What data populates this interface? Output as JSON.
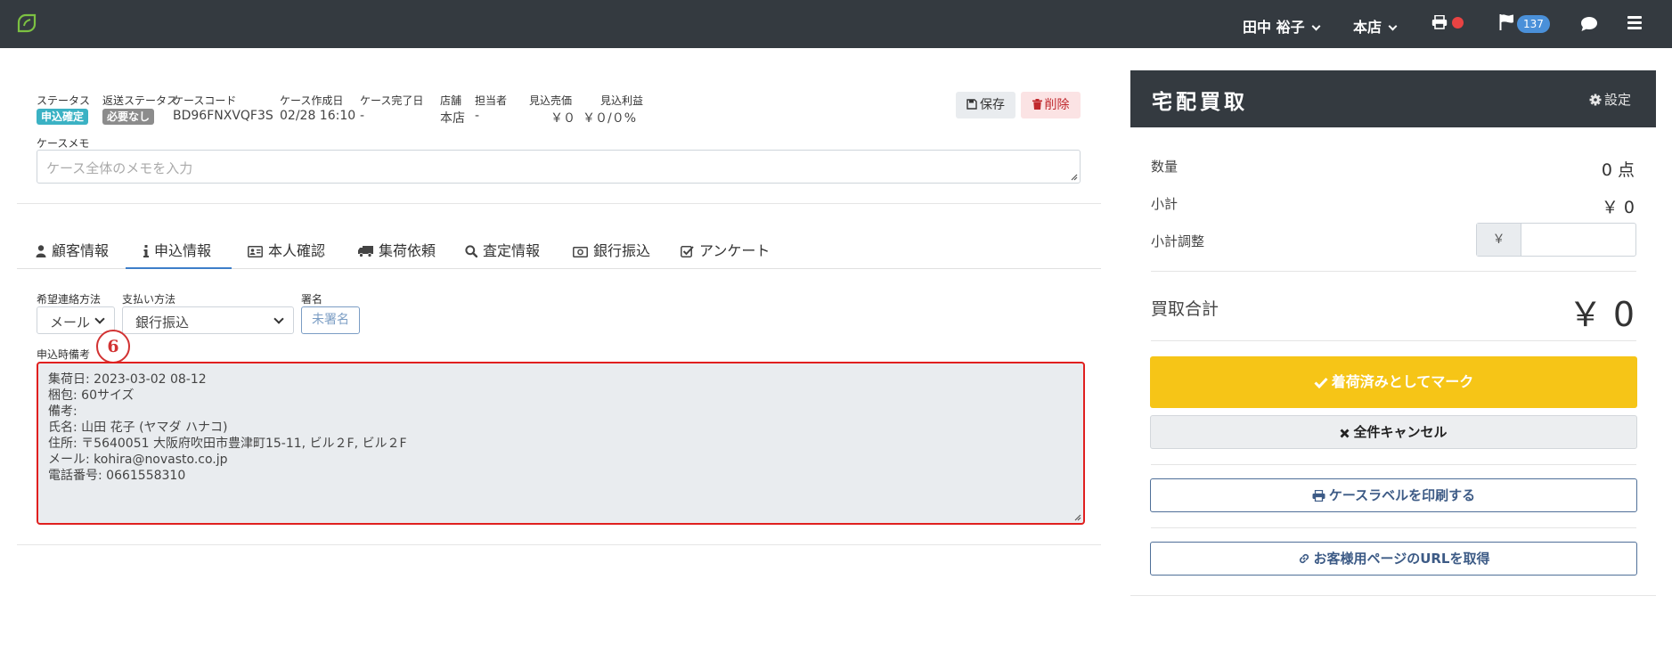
{
  "nav": {
    "user_name": "田中 裕子",
    "store": "本店",
    "notification_count": "137"
  },
  "case": {
    "labels": {
      "status": "ステータス",
      "return_status": "返送ステータス",
      "case_code": "ケースコード",
      "created": "ケース作成日",
      "completed": "ケース完了日",
      "store": "店舗",
      "staff": "担当者",
      "expected_sales": "見込売価",
      "expected_profit": "見込利益"
    },
    "status_badge": "申込確定",
    "return_status_badge": "必要なし",
    "case_code": "BD96FNXVQF3S",
    "created": "02/28 16:10",
    "completed": "-",
    "store": "本店",
    "staff": "-",
    "expected_sales": "￥０",
    "expected_profit": "￥０/０%",
    "save_label": "保存",
    "delete_label": "削除",
    "memo_label": "ケースメモ",
    "memo_placeholder": "ケース全体のメモを入力"
  },
  "tabs": [
    {
      "label": "顧客情報",
      "icon": "user-icon"
    },
    {
      "label": "申込情報",
      "icon": "info-icon"
    },
    {
      "label": "本人確認",
      "icon": "id-card-icon"
    },
    {
      "label": "集荷依頼",
      "icon": "truck-icon"
    },
    {
      "label": "査定情報",
      "icon": "search-icon"
    },
    {
      "label": "銀行振込",
      "icon": "money-icon"
    },
    {
      "label": "アンケート",
      "icon": "checkbox-icon"
    }
  ],
  "form": {
    "contact_label": "希望連絡方法",
    "contact_value": "メール",
    "payment_label": "支払い方法",
    "payment_value": "銀行振込",
    "sign_label": "署名",
    "sign_button": "未署名",
    "remarks_label": "申込時備考",
    "step_number": "6",
    "remarks_lines": [
      "集荷日: 2023-03-02 08-12",
      "梱包: 60サイズ",
      "備考:",
      "氏名: 山田 花子 (ヤマダ ハナコ)",
      "住所: 〒5640051 大阪府吹田市豊津町15-11, ビル２F, ビル２F",
      "メール: kohira@novasto.co.jp",
      "電話番号: 0661558310"
    ]
  },
  "panel": {
    "title": "宅配買取",
    "settings_label": "設定",
    "quantity_label": "数量",
    "quantity_value": "0 点",
    "subtotal_label": "小計",
    "subtotal_value": "￥ 0",
    "adjust_label": "小計調整",
    "adjust_prefix": "￥",
    "adjust_value": "",
    "total_label": "買取合計",
    "total_value": "￥ 0",
    "mark_button": "着荷済みとしてマーク",
    "cancel_button": "全件キャンセル",
    "print_button": "ケースラベルを印刷する",
    "url_button": "お客様用ページのURLを取得"
  },
  "colors": {
    "navbar": "#343a40",
    "status_badge": "#3bb2c4",
    "return_badge": "#8c8c8c",
    "accent_tab": "#3d7ec9",
    "mark_button": "#f6c517",
    "highlight": "#e0201f"
  }
}
